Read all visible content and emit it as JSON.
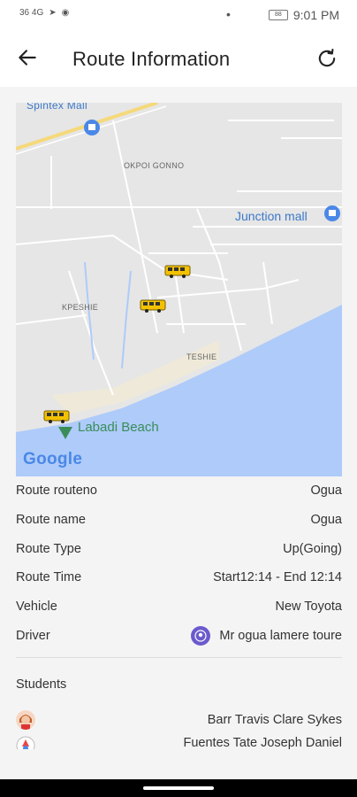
{
  "status_bar": {
    "network": "36 4G",
    "dot": "•",
    "battery": "88",
    "time": "9:01 PM"
  },
  "header": {
    "title": "Route Information",
    "back_icon": "arrow-left-icon",
    "refresh_icon": "refresh-icon"
  },
  "map": {
    "labels": {
      "spintex": "Spintex Mall",
      "okpoi": "OKPOI GONNO",
      "junction": "Junction mall",
      "kpeshie": "KPESHIE",
      "teshie": "TESHIE",
      "labadi": "Labadi Beach",
      "google": "Google"
    },
    "colors": {
      "water": "#aecbfa",
      "land": "#e6e6e6",
      "road": "#ffffff",
      "highway": "#f5d97a"
    }
  },
  "details": {
    "rows": [
      {
        "label": "Route routeno",
        "value": "Ogua"
      },
      {
        "label": "Route name",
        "value": "Ogua"
      },
      {
        "label": "Route Type",
        "value": "Up(Going)"
      },
      {
        "label": "Route Time",
        "value": "Start12:14 - End 12:14"
      },
      {
        "label": "Vehicle",
        "value": "New Toyota"
      },
      {
        "label": "Driver",
        "value": "Mr ogua lamere toure"
      }
    ]
  },
  "students": {
    "title": "Students",
    "items": [
      {
        "name": "Barr Travis Clare Sykes"
      },
      {
        "name": "Fuentes Tate Joseph Daniel"
      }
    ]
  }
}
